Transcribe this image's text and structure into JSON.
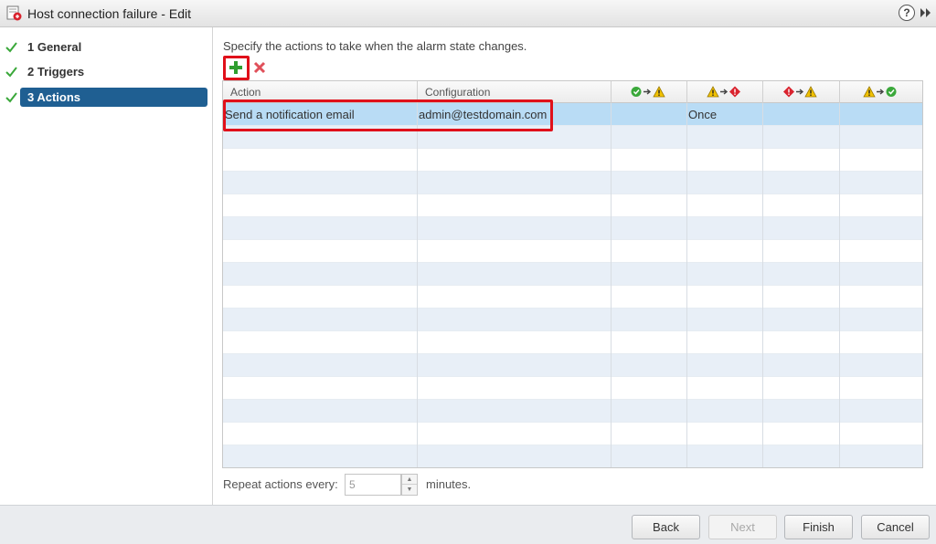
{
  "window": {
    "title": "Host connection failure - Edit",
    "help_glyph": "?"
  },
  "nav": {
    "items": [
      {
        "label": "1  General",
        "completed": true,
        "active": false
      },
      {
        "label": "2  Triggers",
        "completed": true,
        "active": false
      },
      {
        "label": "3  Actions",
        "completed": true,
        "active": true
      }
    ]
  },
  "content": {
    "instruction": "Specify the actions to take when the alarm state changes."
  },
  "toolbar": {
    "add_icon": "add-icon",
    "remove_icon": "remove-icon"
  },
  "table": {
    "columns": [
      {
        "label": "Action"
      },
      {
        "label": "Configuration"
      },
      {
        "icon": "ok-to-warning-icon"
      },
      {
        "icon": "warning-to-critical-icon"
      },
      {
        "icon": "critical-to-warning-icon"
      },
      {
        "icon": "warning-to-ok-icon"
      }
    ],
    "rows": [
      {
        "action": "Send a notification email",
        "configuration": "admin@testdomain.com",
        "ok_to_warning": "",
        "warning_to_critical": "Once",
        "critical_to_warning": "",
        "warning_to_ok": "",
        "selected": true
      }
    ]
  },
  "repeat": {
    "label": "Repeat actions every:",
    "value": "5",
    "unit": "minutes."
  },
  "footer": {
    "back": "Back",
    "next": "Next",
    "finish": "Finish",
    "cancel": "Cancel"
  },
  "colors": {
    "nav_active": "#1f5f92",
    "row_selected": "#b9dcf5",
    "row_alt": "#e8eff7",
    "highlight": "#e0101a",
    "check_green": "#3aa83a"
  }
}
